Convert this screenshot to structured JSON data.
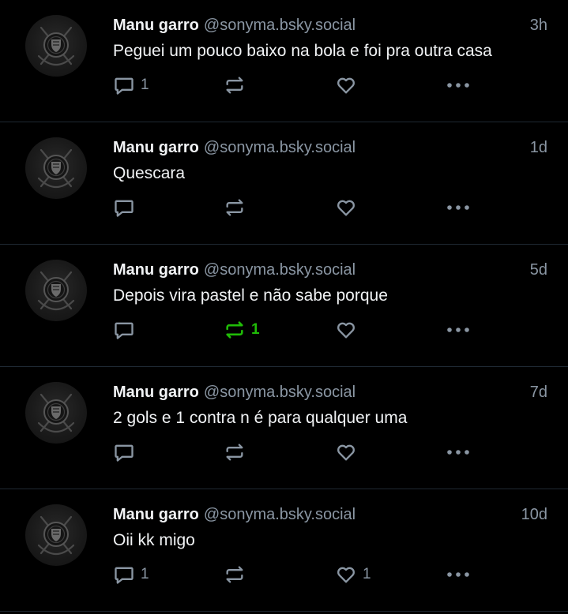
{
  "colors": {
    "background": "#000000",
    "separator": "#1f2933",
    "muted": "#8a96a3",
    "text": "#f1f3f5",
    "repost_active": "#20bc07"
  },
  "icons": {
    "reply": "chat-bubble-icon",
    "repost": "repost-arrows-icon",
    "like": "heart-icon",
    "more": "ellipsis-icon"
  },
  "posts": [
    {
      "author_name": "Manu garro",
      "author_handle": "@sonyma.bsky.social",
      "time": "3h",
      "text": "Peguei um pouco baixo na bola e foi pra outra casa",
      "reply_count": "1",
      "repost_count": "",
      "like_count": "",
      "reposted": false
    },
    {
      "author_name": "Manu garro",
      "author_handle": "@sonyma.bsky.social",
      "time": "1d",
      "text": "Quescara",
      "reply_count": "",
      "repost_count": "",
      "like_count": "",
      "reposted": false
    },
    {
      "author_name": "Manu garro",
      "author_handle": "@sonyma.bsky.social",
      "time": "5d",
      "text": "Depois vira pastel e não sabe porque",
      "reply_count": "",
      "repost_count": "1",
      "like_count": "",
      "reposted": true
    },
    {
      "author_name": "Manu garro",
      "author_handle": "@sonyma.bsky.social",
      "time": "7d",
      "text": "2 gols e 1 contra n é para qualquer uma",
      "reply_count": "",
      "repost_count": "",
      "like_count": "",
      "reposted": false
    },
    {
      "author_name": "Manu garro",
      "author_handle": "@sonyma.bsky.social",
      "time": "10d",
      "text": "Oii kk migo",
      "reply_count": "1",
      "repost_count": "",
      "like_count": "1",
      "reposted": false
    }
  ]
}
